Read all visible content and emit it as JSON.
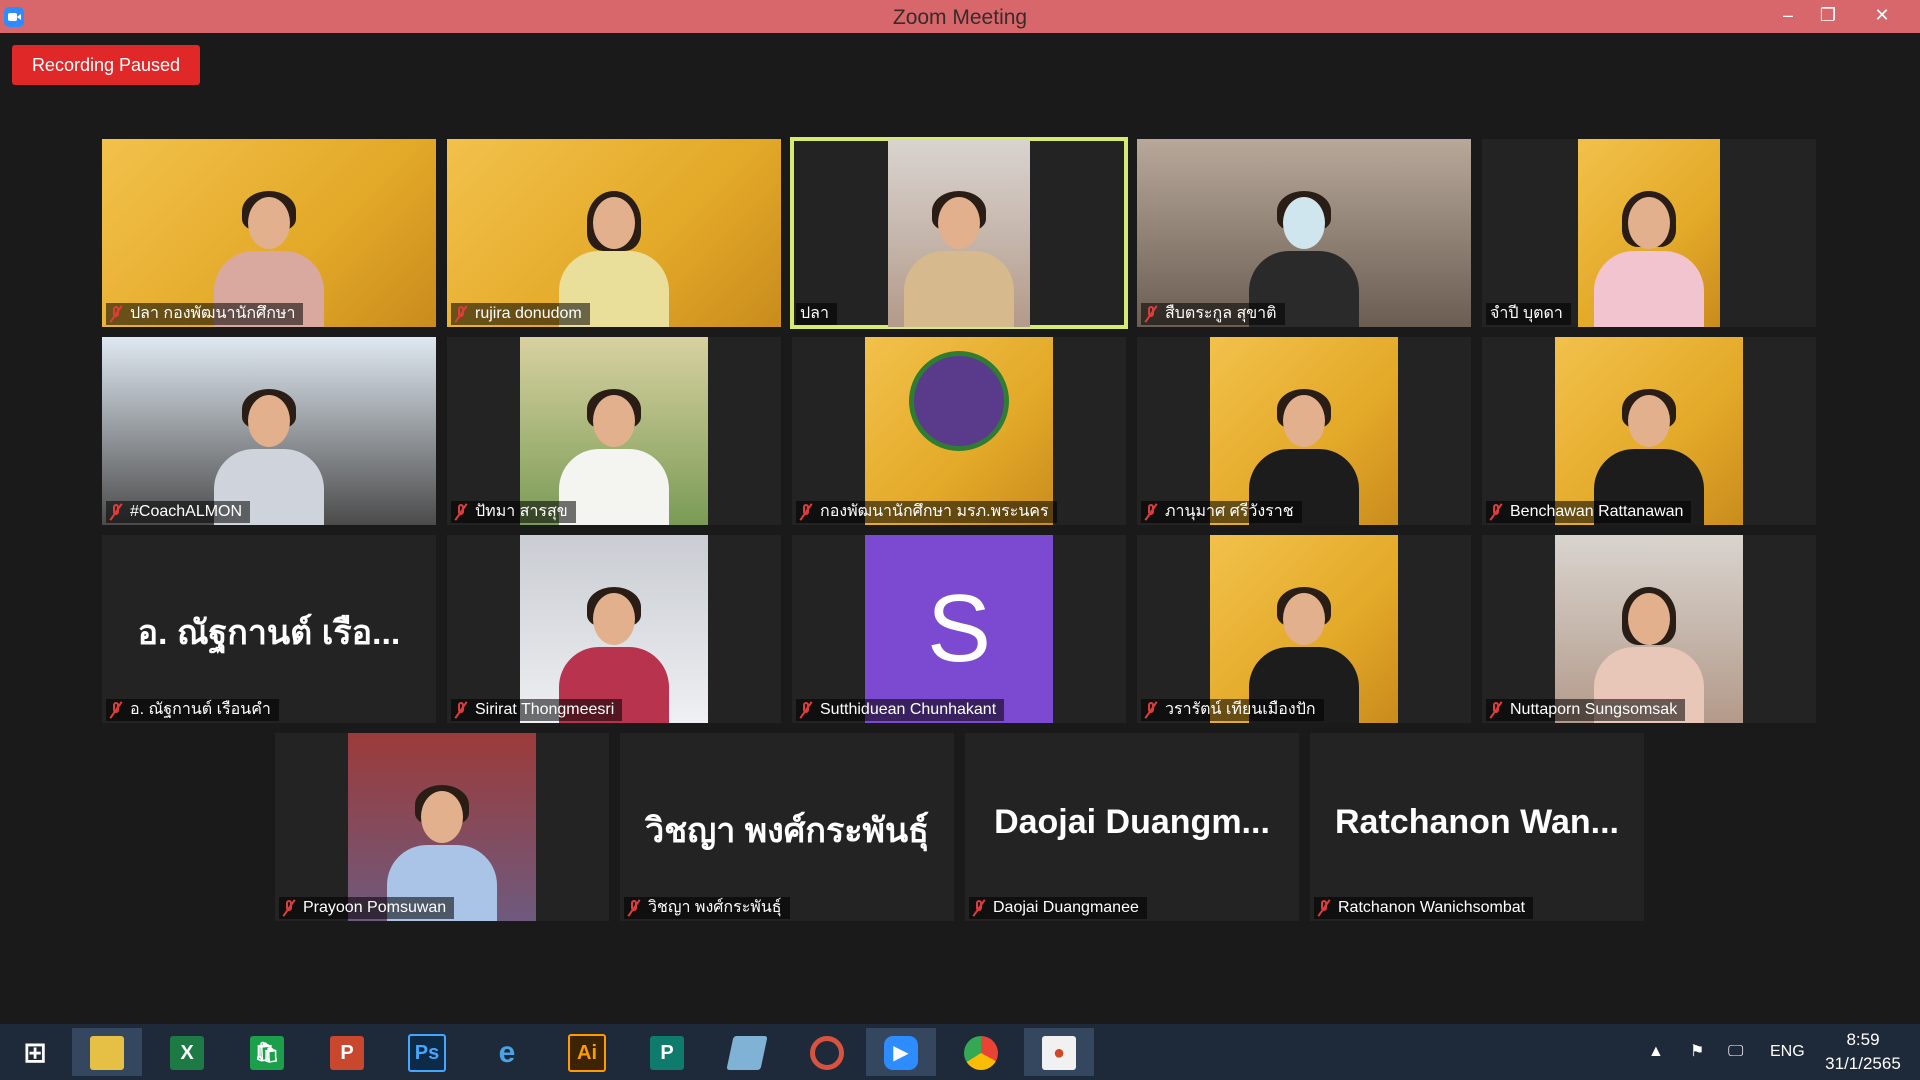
{
  "window": {
    "title": "Zoom Meeting",
    "minimize": "–",
    "restore": "❐",
    "close": "✕"
  },
  "recording_badge": "Recording Paused",
  "participants": [
    {
      "name": "ปลา กองพัฒนานักศึกษา",
      "muted": true
    },
    {
      "name": "rujira donudom",
      "muted": true
    },
    {
      "name": "ปลา",
      "muted": false,
      "active_speaker": true
    },
    {
      "name": "สืบตระกูล สุขาติ",
      "muted": true
    },
    {
      "name": "จำปี บุตดา",
      "muted": false
    },
    {
      "name": "#CoachALMON",
      "muted": true
    },
    {
      "name": "ปัทมา สารสุข",
      "muted": true
    },
    {
      "name": "กองพัฒนานักศึกษา มรภ.พระนคร",
      "muted": true
    },
    {
      "name": "ภานุมาศ ศรีวังราช",
      "muted": true
    },
    {
      "name": "Benchawan Rattanawan",
      "muted": true
    },
    {
      "name": "อ. ณัฐกานต์ เรือนคำ",
      "muted": true,
      "display_text": "อ. ณัฐกานต์ เรือ..."
    },
    {
      "name": "Sirirat Thongmeesri",
      "muted": true
    },
    {
      "name": "Sutthiduean Chunhakant",
      "muted": true,
      "avatar_letter": "S"
    },
    {
      "name": "วรารัตน์ เทียนเมืองปัก",
      "muted": true
    },
    {
      "name": "Nuttaporn Sungsomsak",
      "muted": true
    },
    {
      "name": "Prayoon Pomsuwan",
      "muted": true
    },
    {
      "name": "วิชญา พงศ์กระพันธุ์",
      "muted": true,
      "display_text": "วิชญา พงศ์กระพันธุ์"
    },
    {
      "name": "Daojai Duangmanee",
      "muted": true,
      "display_text": "Daojai Duangm..."
    },
    {
      "name": "Ratchanon Wanichsombat",
      "muted": true,
      "display_text": "Ratchanon Wan..."
    }
  ],
  "taskbar": {
    "apps": [
      "Start",
      "File Explorer",
      "Excel",
      "Store",
      "PowerPoint",
      "Photoshop",
      "Internet Explorer",
      "Illustrator",
      "Publisher",
      "Notepad",
      "PhotoScape",
      "Zoom",
      "Chrome",
      "PowerPoint Viewer"
    ],
    "tray": {
      "language": "ENG",
      "time": "8:59",
      "date": "31/1/2565"
    }
  }
}
